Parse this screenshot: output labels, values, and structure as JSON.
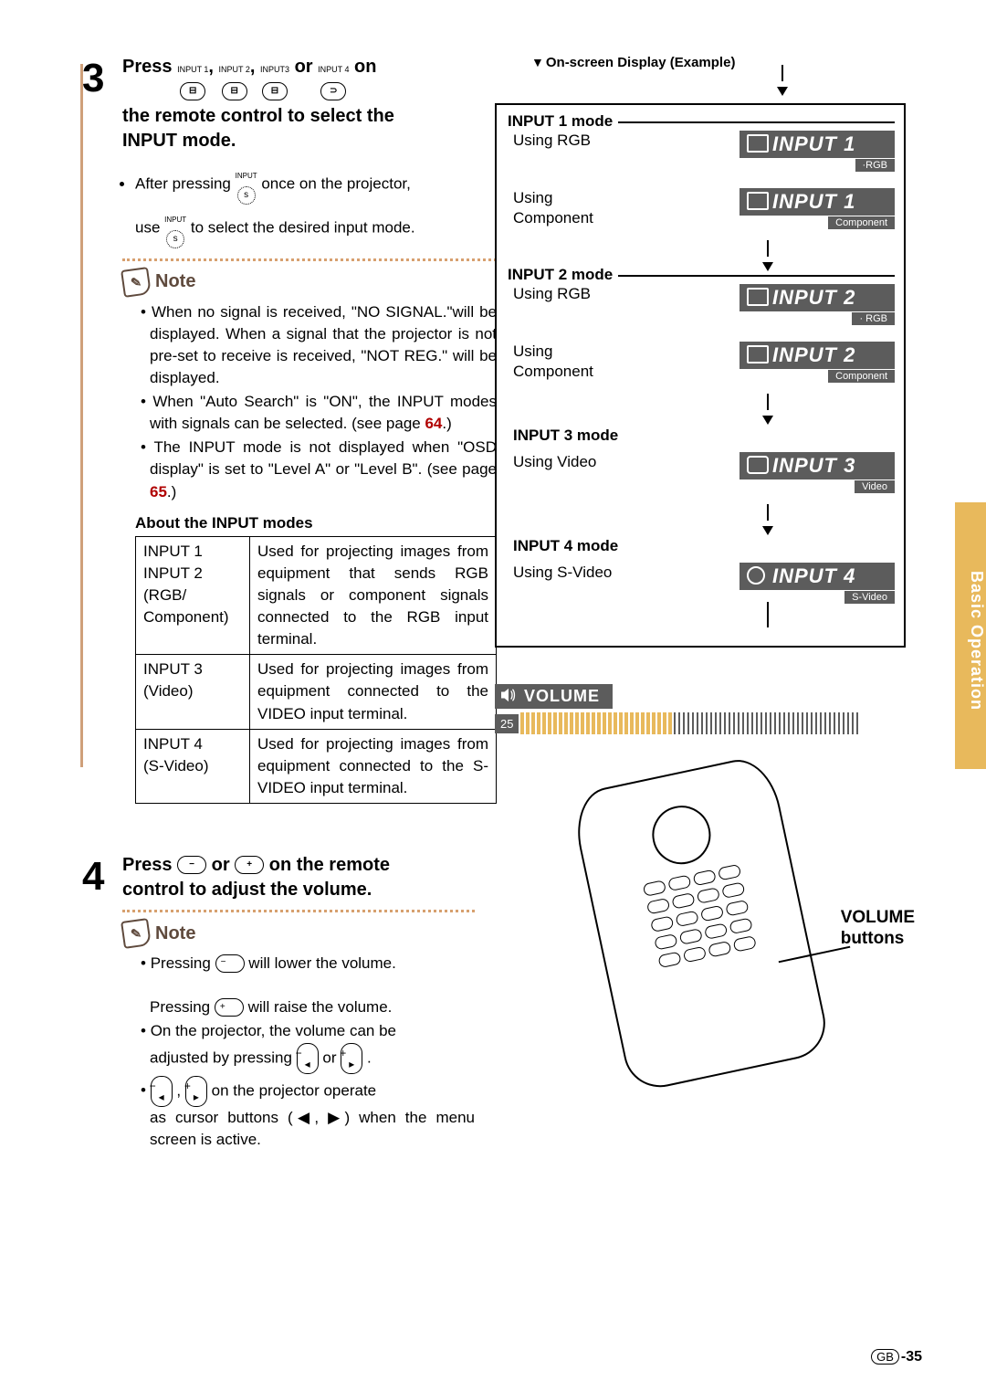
{
  "sideTab": "Basic Operation",
  "step3": {
    "num": "3",
    "title_pre": "Press ",
    "icon1_label": "INPUT 1",
    "icon2_label": "INPUT 2",
    "icon3_label": "INPUT3",
    "icon4_label": "INPUT 4",
    "sep": ", ",
    "or": " or ",
    "on": " on",
    "line2": "the remote control to select the",
    "line3": "INPUT mode.",
    "bullet1_a": "After pressing ",
    "bullet1_b": " once on the projector,",
    "bullet1_c": "use ",
    "bullet1_d": " to select the desired input mode.",
    "inputLabelSmall": "INPUT"
  },
  "noteLabel": "Note",
  "note3": {
    "li1": "When no signal is received, \"NO SIGNAL.\"will be displayed. When a signal that the projector is not pre-set to receive is received, \"NOT REG.\" will be displayed.",
    "li2a": "When \"Auto Search\" is \"ON\", the INPUT modes with signals can be selected. (see page ",
    "li2_page": "64",
    "li2b": ".)",
    "li3a": "The INPUT mode is not displayed when \"OSD display\" is set to \"Level A\" or \"Level B\". (see page ",
    "li3_page": "65",
    "li3b": ".)"
  },
  "tableHead": "About the INPUT modes",
  "table": {
    "r1c1": "INPUT 1\nINPUT 2\n(RGB/\nComponent)",
    "r1c2": "Used for projecting images from equipment that sends RGB signals or component signals connected to the RGB input terminal.",
    "r2c1": "INPUT 3\n(Video)",
    "r2c2": "Used for projecting images from equipment connected to the VIDEO input terminal.",
    "r3c1": "INPUT 4\n(S-Video)",
    "r3c2": "Used for projecting images from equipment connected to the S-VIDEO input terminal."
  },
  "step4": {
    "num": "4",
    "title_a": "Press ",
    "title_b": " or ",
    "title_c": " on the remote",
    "title_line2": "control to adjust the volume."
  },
  "note4": {
    "li1a": "Pressing ",
    "li1b": " will lower the volume.",
    "li2a": "Pressing ",
    "li2b": " will raise the volume.",
    "li3": "On the projector, the volume can be",
    "li3b_a": "adjusted by pressing ",
    "li3b_b": " or ",
    "li3b_c": " .",
    "li4a": " , ",
    "li4b": " on the projector operate",
    "li4c": "as cursor buttons (◀, ▶) when the menu screen is active."
  },
  "osdHead": "On-screen Display (Example)",
  "modes": {
    "m1": "INPUT 1 mode",
    "m1a": "Using RGB",
    "m1a_badge": "INPUT 1",
    "m1a_sub": "·RGB",
    "m1b": "Using Component",
    "m1b_badge": "INPUT 1",
    "m1b_sub": "Component",
    "m2": "INPUT 2 mode",
    "m2a": "Using RGB",
    "m2a_badge": "INPUT 2",
    "m2a_sub": "· RGB",
    "m2b": "Using Component",
    "m2b_badge": "INPUT 2",
    "m2b_sub": "Component",
    "m3": "INPUT 3 mode",
    "m3a": "Using Video",
    "m3a_badge": "INPUT 3",
    "m3a_sub": "Video",
    "m4": "INPUT 4 mode",
    "m4a": "Using S-Video",
    "m4a_badge": "INPUT 4",
    "m4a_sub": "S-Video"
  },
  "volume": {
    "label": "VOLUME",
    "value": "25"
  },
  "remoteLabel": "VOLUME buttons",
  "footer": {
    "gb": "GB",
    "page": "-35"
  }
}
